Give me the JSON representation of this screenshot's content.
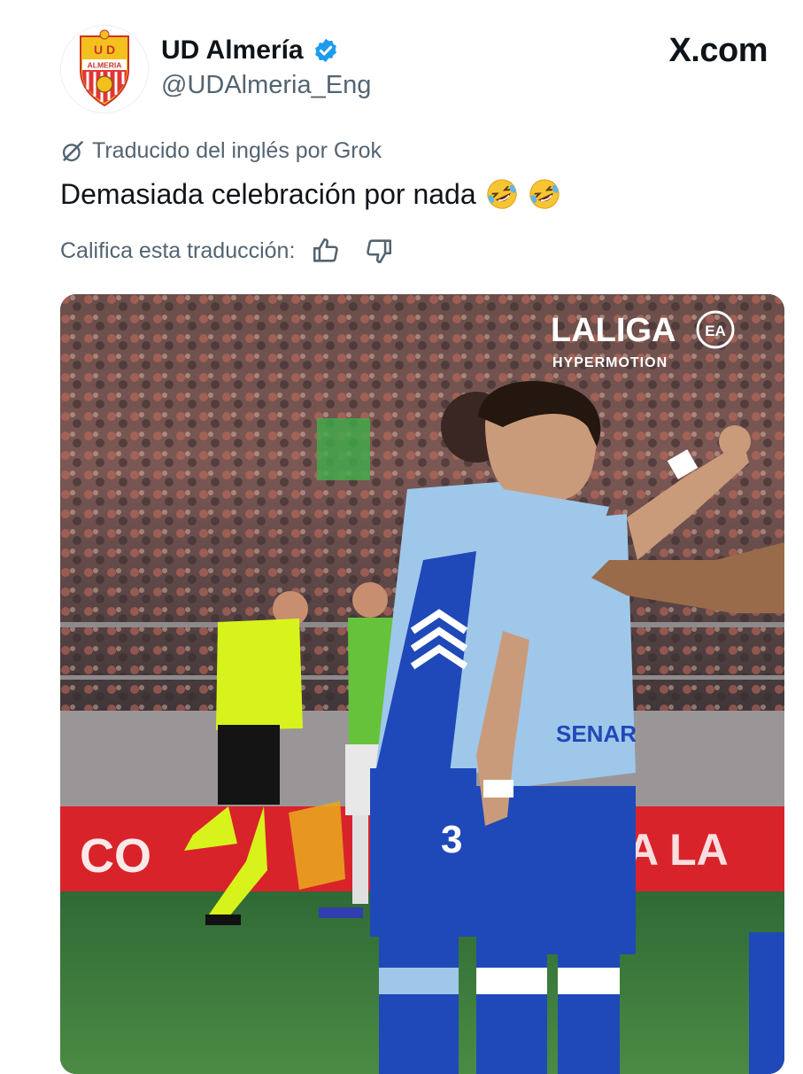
{
  "account": {
    "display_name": "UD Almería",
    "handle": "@UDAlmeria_Eng",
    "avatar_icon": "ud-almeria-crest-icon",
    "crest_text_top": "U D",
    "crest_text_band": "ALMERIA",
    "verified_icon": "verified-badge-icon",
    "verified_color": "#1d9bf0"
  },
  "brand": {
    "label": "X.com"
  },
  "translation": {
    "icon": "grok-icon",
    "label": "Traducido del inglés por Grok"
  },
  "tweet": {
    "text": "Demasiada celebración por nada",
    "emojis": [
      "rolling-on-floor-laughing-icon",
      "rolling-on-floor-laughing-icon"
    ]
  },
  "rating": {
    "label": "Califica esta traducción:",
    "thumbs_up_icon": "thumbs-up-icon",
    "thumbs_down_icon": "thumbs-down-icon"
  },
  "media": {
    "broadcast_logo_main": "LALIGA",
    "broadcast_logo_badge": "EA",
    "broadcast_logo_sub": "HYPERMOTION",
    "shirt_number": "3",
    "shirt_sponsor": "SENAR",
    "board_text": "CO",
    "board_text_right": "A  LA"
  },
  "colors": {
    "text_primary": "#0f1419",
    "text_secondary": "#536471",
    "kit_light_blue": "#9fc7ea",
    "kit_royal_blue": "#1f49b8",
    "referee_yellow": "#d8f21c",
    "pitch_green": "#3f7a3c",
    "board_red": "#d9232b"
  }
}
